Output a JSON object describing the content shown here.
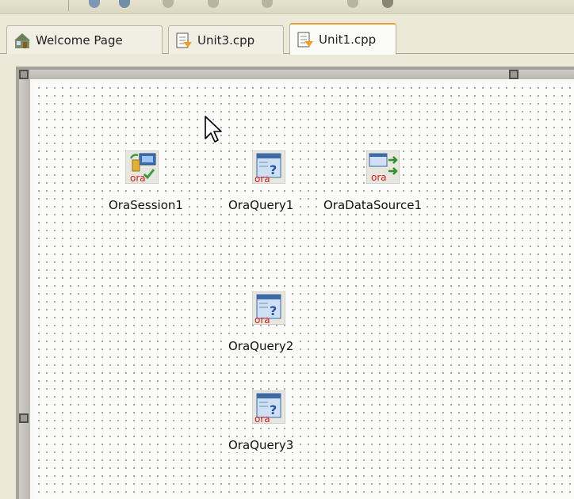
{
  "tabs": [
    {
      "label": "Welcome Page",
      "icon": "home-icon"
    },
    {
      "label": "Unit3.cpp",
      "icon": "cpp-unit-icon"
    },
    {
      "label": "Unit1.cpp",
      "icon": "cpp-unit-icon",
      "active": true
    }
  ],
  "components": {
    "session1": {
      "label": "OraSession1",
      "icon": "ora-session-icon"
    },
    "query1": {
      "label": "OraQuery1",
      "icon": "ora-query-icon"
    },
    "datasource1": {
      "label": "OraDataSource1",
      "icon": "ora-datasource-icon"
    },
    "query2": {
      "label": "OraQuery2",
      "icon": "ora-query-icon"
    },
    "query3": {
      "label": "OraQuery3",
      "icon": "ora-query-icon"
    }
  },
  "icon_text": {
    "ora": "ora",
    "question": "?"
  },
  "colors": {
    "tab_active_accent": "#e9a13b",
    "ora_red": "#d21f1f"
  }
}
